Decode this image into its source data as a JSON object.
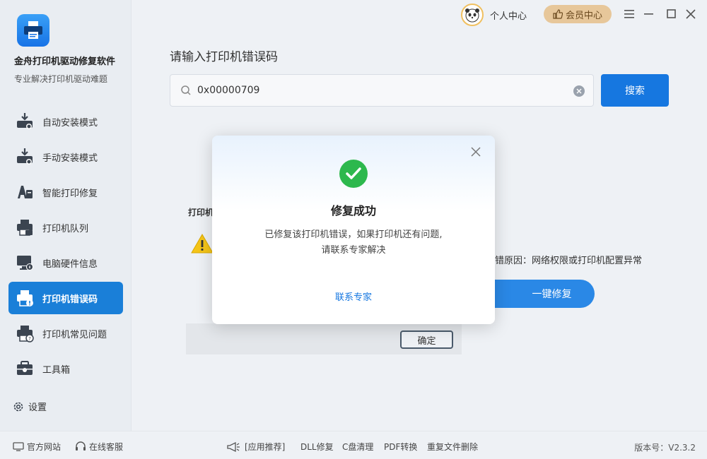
{
  "app": {
    "title": "金舟打印机驱动修复软件",
    "subtitle": "专业解决打印机驱动难题"
  },
  "nav": [
    {
      "label": "自动安装模式",
      "icon": "auto-install-icon"
    },
    {
      "label": "手动安装模式",
      "icon": "manual-install-icon"
    },
    {
      "label": "智能打印修复",
      "icon": "smart-repair-icon"
    },
    {
      "label": "打印机队列",
      "icon": "printer-queue-icon"
    },
    {
      "label": "电脑硬件信息",
      "icon": "hardware-info-icon"
    },
    {
      "label": "打印机错误码",
      "icon": "error-code-icon",
      "active": true
    },
    {
      "label": "打印机常见问题",
      "icon": "faq-icon"
    },
    {
      "label": "工具箱",
      "icon": "toolbox-icon"
    }
  ],
  "settings_label": "设置",
  "topbar": {
    "personal_center": "个人中心",
    "vip_center": "会员中心"
  },
  "main": {
    "title": "请输入打印机错误码",
    "search_value": "0x00000709",
    "search_button": "搜索",
    "bg_label": "打印机",
    "cause_text": "错原因：网络权限或打印机配置异常",
    "fix_button": "一键修复",
    "ok_button": "确定"
  },
  "modal": {
    "title": "修复成功",
    "message_line1": "已修复该打印机错误，如果打印机还有问题,",
    "message_line2": "请联系专家解决",
    "contact": "联系专家"
  },
  "footer": {
    "official_site": "官方网站",
    "online_service": "在线客服",
    "recommend": "[应用推荐]",
    "dll": "DLL修复",
    "c_clean": "C盘清理",
    "pdf": "PDF转换",
    "dup_delete": "重复文件删除",
    "version": "版本号：V2.3.2"
  },
  "colors": {
    "accent": "#1677e0",
    "active_nav": "#1a7fd8",
    "success": "#2db84d",
    "vip": "#e7c79a"
  }
}
